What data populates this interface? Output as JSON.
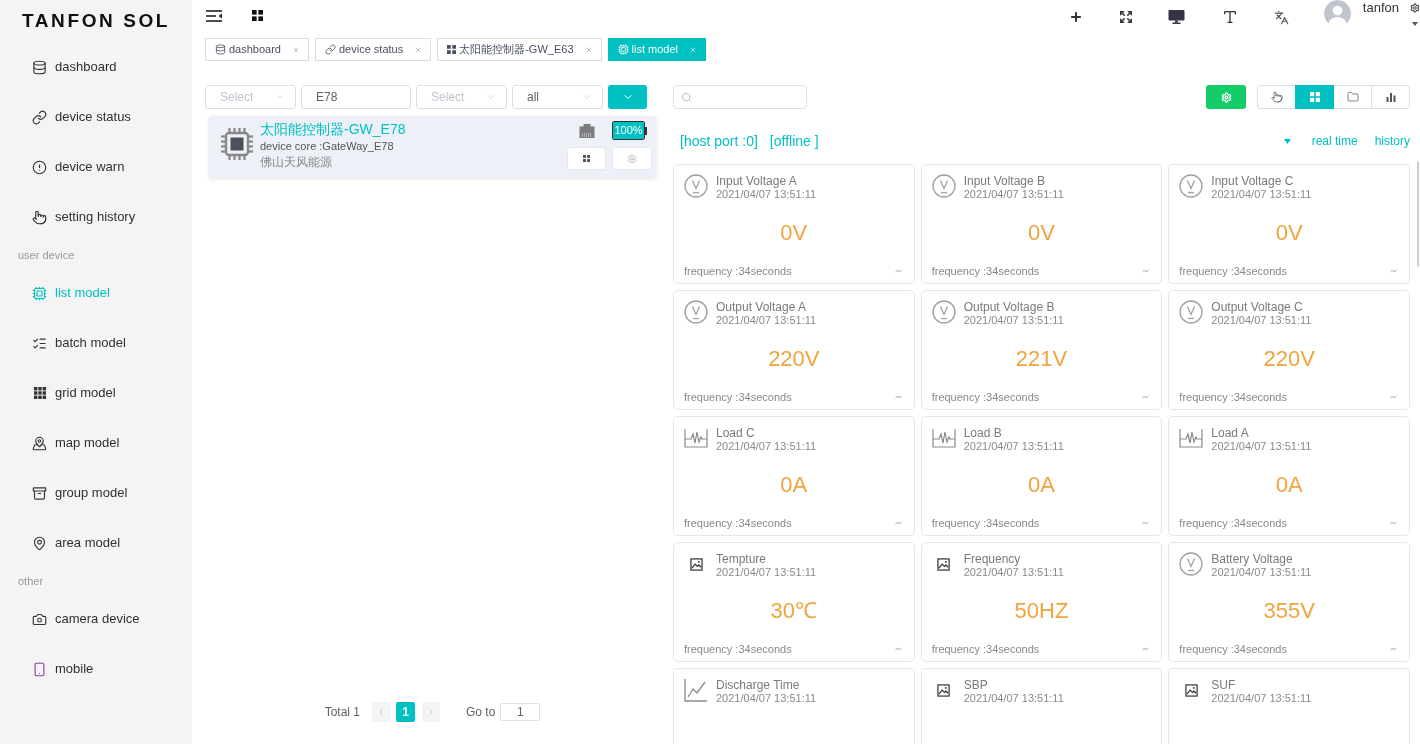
{
  "sidebar": {
    "logo": "TANFON SOL",
    "sections": [
      {
        "items": [
          {
            "label": "dashboard",
            "selected": false
          },
          {
            "label": "device status",
            "selected": false
          },
          {
            "label": "device warn",
            "selected": false
          },
          {
            "label": "setting history",
            "selected": false
          }
        ]
      },
      {
        "title": "user device",
        "items": [
          {
            "label": "list model",
            "selected": true
          },
          {
            "label": "batch model",
            "selected": false
          },
          {
            "label": "grid model",
            "selected": false
          },
          {
            "label": "map model",
            "selected": false
          },
          {
            "label": "group model",
            "selected": false
          },
          {
            "label": "area model",
            "selected": false
          }
        ]
      },
      {
        "title": "other",
        "items": [
          {
            "label": "camera device",
            "selected": false
          },
          {
            "label": "mobile",
            "selected": false
          }
        ]
      }
    ]
  },
  "header": {
    "user": "tanfon"
  },
  "tabs": [
    {
      "label": "dashboard",
      "selected": false
    },
    {
      "label": "device status",
      "selected": false
    },
    {
      "label": "太阳能控制器-GW_E63",
      "selected": false
    },
    {
      "label": "list model",
      "selected": true
    }
  ],
  "filters": {
    "select_1": {
      "placeholder": "Select"
    },
    "search": {
      "value": "E78"
    },
    "select_2": {
      "placeholder": "Select"
    },
    "select_3": {
      "value": "all"
    }
  },
  "devices": [
    {
      "name": "太阳能控制器-GW_E78",
      "core": "device core :GateWay_E78",
      "company": "佛山天风能源",
      "battery": "100%",
      "level": 1
    }
  ],
  "pagination": {
    "total": "Total 1",
    "pages": [
      {
        "label": "1",
        "selected": true
      }
    ],
    "goto_label": "Go to",
    "goto_value": "1"
  },
  "toolbar": {
    "views": [
      {
        "kind": "touch",
        "selected": false
      },
      {
        "kind": "grid",
        "selected": true
      },
      {
        "kind": "folder",
        "selected": false
      },
      {
        "kind": "chart",
        "selected": false
      }
    ]
  },
  "status": {
    "host_port": "[host port :0]",
    "connection": "[offline ]",
    "links": [
      "real time",
      "history"
    ]
  },
  "cards": [
    {
      "kind": "voltage",
      "title": "Input Voltage A",
      "time": "2021/04/07 13:51:11",
      "value": "0V",
      "frequency": "frequency :34seconds"
    },
    {
      "kind": "voltage",
      "title": "Input Voltage B",
      "time": "2021/04/07 13:51:11",
      "value": "0V",
      "frequency": "frequency :34seconds"
    },
    {
      "kind": "voltage",
      "title": "Input Voltage C",
      "time": "2021/04/07 13:51:11",
      "value": "0V",
      "frequency": "frequency :34seconds"
    },
    {
      "kind": "voltage",
      "title": "Output Voltage A",
      "time": "2021/04/07 13:51:11",
      "value": "220V",
      "frequency": "frequency :34seconds"
    },
    {
      "kind": "voltage",
      "title": "Output Voltage B",
      "time": "2021/04/07 13:51:11",
      "value": "221V",
      "frequency": "frequency :34seconds"
    },
    {
      "kind": "voltage",
      "title": "Output Voltage C",
      "time": "2021/04/07 13:51:11",
      "value": "220V",
      "frequency": "frequency :34seconds"
    },
    {
      "kind": "wave",
      "title": "Load C",
      "time": "2021/04/07 13:51:11",
      "value": "0A",
      "frequency": "frequency :34seconds"
    },
    {
      "kind": "wave",
      "title": "Load B",
      "time": "2021/04/07 13:51:11",
      "value": "0A",
      "frequency": "frequency :34seconds"
    },
    {
      "kind": "wave",
      "title": "Load A",
      "time": "2021/04/07 13:51:11",
      "value": "0A",
      "frequency": "frequency :34seconds"
    },
    {
      "kind": "image",
      "title": "Tempture",
      "time": "2021/04/07 13:51:11",
      "value": "30℃",
      "frequency": "frequency :34seconds"
    },
    {
      "kind": "image",
      "title": "Frequency",
      "time": "2021/04/07 13:51:11",
      "value": "50HZ",
      "frequency": "frequency :34seconds"
    },
    {
      "kind": "voltage",
      "title": "Battery Voltage",
      "time": "2021/04/07 13:51:11",
      "value": "355V",
      "frequency": "frequency :34seconds"
    },
    {
      "kind": "trend",
      "title": "Discharge Time",
      "time": "2021/04/07 13:51:11"
    },
    {
      "kind": "image",
      "title": "SBP",
      "time": "2021/04/07 13:51:11"
    },
    {
      "kind": "image",
      "title": "SUF",
      "time": "2021/04/07 13:51:11"
    }
  ]
}
